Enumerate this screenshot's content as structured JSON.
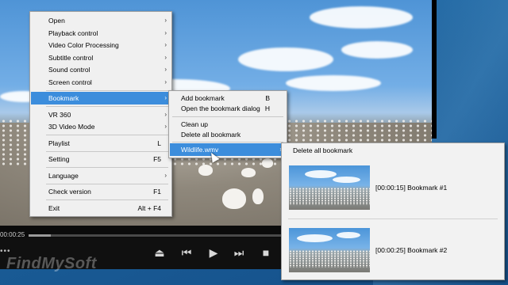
{
  "player": {
    "time": "00:00:25",
    "progress": 0.055,
    "controls": [
      "eject-icon",
      "previous-icon",
      "play-icon",
      "next-icon",
      "stop-icon"
    ],
    "watermark": "FindMySoft"
  },
  "main_menu": [
    {
      "label": "Open",
      "shortcut": "",
      "submenu": true
    },
    {
      "label": "Playback control",
      "shortcut": "",
      "submenu": true
    },
    {
      "label": "Video Color Processing",
      "shortcut": "",
      "submenu": true
    },
    {
      "label": "Subtitle control",
      "shortcut": "",
      "submenu": true
    },
    {
      "label": "Sound control",
      "shortcut": "",
      "submenu": true
    },
    {
      "label": "Screen control",
      "shortcut": "",
      "submenu": true
    },
    {
      "label": "Bookmark",
      "shortcut": "",
      "submenu": true,
      "selected": true
    },
    {
      "label": "VR 360",
      "shortcut": "",
      "submenu": true
    },
    {
      "label": "3D Video Mode",
      "shortcut": "",
      "submenu": true
    },
    {
      "label": "Playlist",
      "shortcut": "L",
      "submenu": false
    },
    {
      "label": "Setting",
      "shortcut": "F5",
      "submenu": false
    },
    {
      "label": "Language",
      "shortcut": "",
      "submenu": true
    },
    {
      "label": "Check version",
      "shortcut": "F1",
      "submenu": false
    },
    {
      "label": "Exit",
      "shortcut": "Alt + F4",
      "submenu": false
    }
  ],
  "bookmark_menu": [
    {
      "label": "Add bookmark",
      "shortcut": "B"
    },
    {
      "label": "Open the bookmark dialog",
      "shortcut": "H"
    },
    {
      "label": "Clean up",
      "shortcut": ""
    },
    {
      "label": "Delete all bookmark",
      "shortcut": ""
    },
    {
      "label": "Wildlife.wmv",
      "shortcut": "",
      "submenu": true,
      "selected": true
    }
  ],
  "bookmark_panel": {
    "header": "Delete all bookmark",
    "items": [
      {
        "label": "[00:00:15] Bookmark #1"
      },
      {
        "label": "[00:00:25] Bookmark #2"
      }
    ]
  },
  "colors": {
    "selection": "#3c8ddc",
    "menu_bg": "#f0f0f0",
    "desktop": "#1d5d96"
  }
}
